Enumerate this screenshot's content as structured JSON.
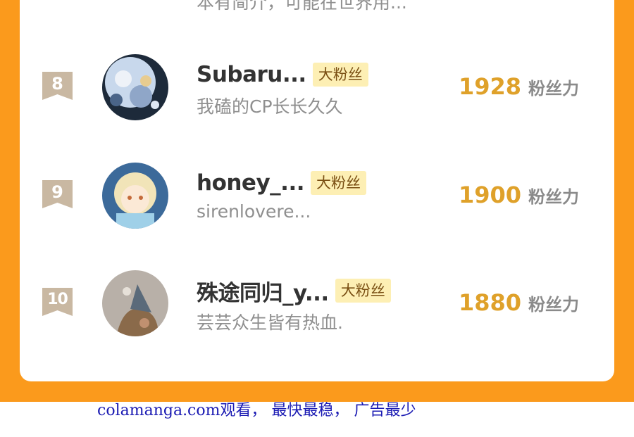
{
  "colors": {
    "frame": "#fb9a1c",
    "card": "#ffffff",
    "rank_badge": "#c9b8a2",
    "fan_badge_bg": "#fdefb4",
    "score": "#dfa12a",
    "watermark": "#1b1bb3"
  },
  "partial_row": {
    "desc": "本有简介，可能在世界用..."
  },
  "rows": [
    {
      "rank": "8",
      "name": "Subaru...",
      "badge": "大粉丝",
      "desc": "我磕的CP长长久久",
      "score": "1928",
      "unit": "粉丝力"
    },
    {
      "rank": "9",
      "name": "honey_...",
      "badge": "大粉丝",
      "desc": "sirenlovere...",
      "score": "1900",
      "unit": "粉丝力"
    },
    {
      "rank": "10",
      "name": "殊途同归_y...",
      "badge": "大粉丝",
      "desc": "芸芸众生皆有热血.",
      "score": "1880",
      "unit": "粉丝力"
    }
  ],
  "watermark": "colamanga.com观看， 最快最稳， 广告最少"
}
